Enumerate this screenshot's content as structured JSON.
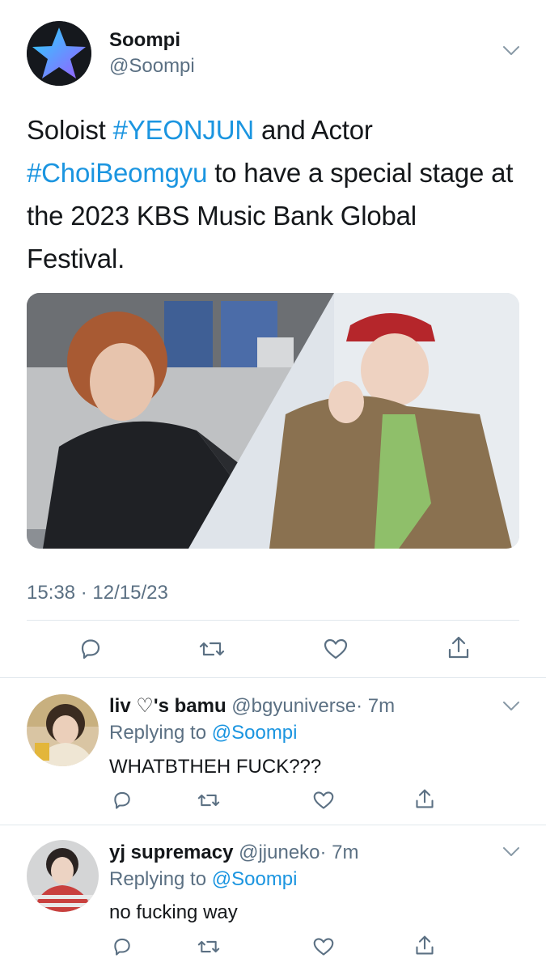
{
  "tweet": {
    "author": {
      "name": "Soompi",
      "handle": "@Soompi",
      "avatar_icon": "star-logo-icon",
      "avatar_colors": {
        "background": "#15181d",
        "star_top": "#27d4ff",
        "star_bottom": "#9b5cff"
      }
    },
    "text": {
      "part1": "Soloist ",
      "hashtag1": "#YEONJUN",
      "part2": " and Actor ",
      "hashtag2": "#ChoiBeomgyu",
      "part3": " to have a special stage at the 2023 KBS Music Bank Global Festival."
    },
    "timestamp": "15:38 · 12/15/23",
    "actions": [
      "reply-icon",
      "retweet-icon",
      "like-icon",
      "share-icon"
    ],
    "menu_icon": "chevron-down-icon"
  },
  "replies": [
    {
      "name": "liv ♡'s bamu",
      "handle": "@bgyuniverse",
      "time": "· 7m",
      "replying_label": "Replying to",
      "replying_to": "@Soompi",
      "text": "WHATBTHEH FUCK???"
    },
    {
      "name": "yj supremacy",
      "handle": "@jjuneko",
      "time": "· 7m",
      "replying_label": "Replying to",
      "replying_to": "@Soompi",
      "text": "no fucking way"
    }
  ],
  "colors": {
    "link": "#1b95e0",
    "secondary_text": "#5b7083",
    "primary_text": "#14171a",
    "divider": "#e1e8ed"
  }
}
